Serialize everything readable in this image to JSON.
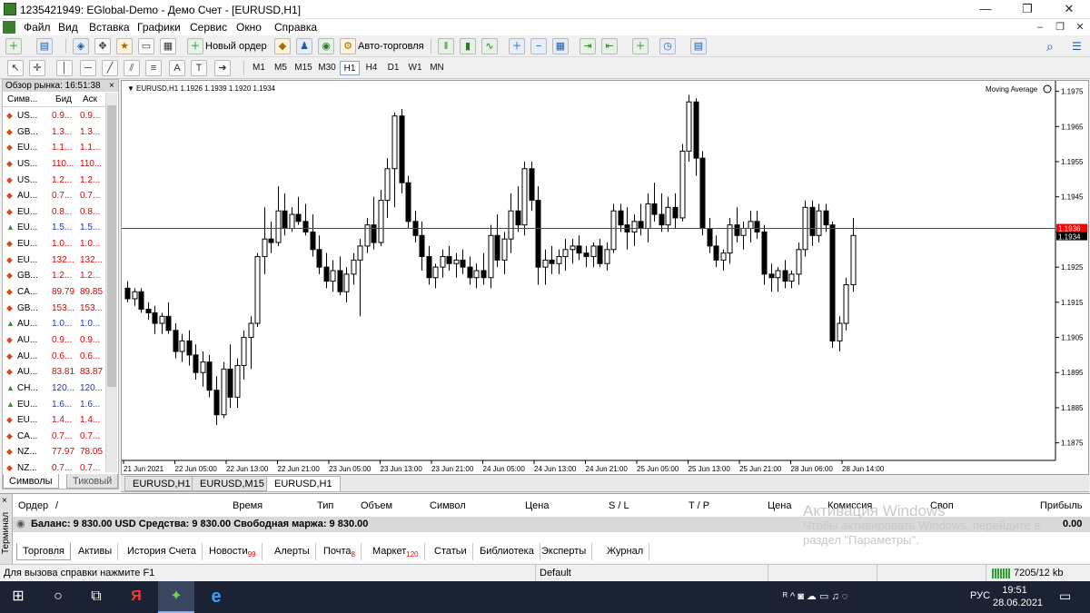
{
  "window": {
    "title": "1235421949: EGlobal-Demo - Демо Счет - [EURUSD,H1]",
    "min": "—",
    "max": "❐",
    "close": "✕",
    "mdi_min": "–",
    "mdi_max": "❐",
    "mdi_close": "✕"
  },
  "menu": [
    "Файл",
    "Вид",
    "Вставка",
    "Графики",
    "Сервис",
    "Окно",
    "Справка"
  ],
  "toolbar": {
    "new_order": "Новый ордер",
    "autotrade": "Авто-торговля",
    "search_icon": "⌕",
    "chat_icon": "☰"
  },
  "timeframes": [
    "M1",
    "M5",
    "M15",
    "M30",
    "H1",
    "H4",
    "D1",
    "W1",
    "MN"
  ],
  "market_watch": {
    "header": "Обзор рынка: 16:51:38",
    "close": "×",
    "columns": [
      "Симв...",
      "Бид",
      "Аск"
    ],
    "rows": [
      {
        "dir": "down",
        "symbol": "US...",
        "bid": "0.9...",
        "ask": "0.9..."
      },
      {
        "dir": "down",
        "symbol": "GB...",
        "bid": "1.3...",
        "ask": "1.3..."
      },
      {
        "dir": "down",
        "symbol": "EU...",
        "bid": "1.1...",
        "ask": "1.1..."
      },
      {
        "dir": "down",
        "symbol": "US...",
        "bid": "110...",
        "ask": "110..."
      },
      {
        "dir": "down",
        "symbol": "US...",
        "bid": "1.2...",
        "ask": "1.2..."
      },
      {
        "dir": "down",
        "symbol": "AU...",
        "bid": "0.7...",
        "ask": "0.7..."
      },
      {
        "dir": "down",
        "symbol": "EU...",
        "bid": "0.8...",
        "ask": "0.8..."
      },
      {
        "dir": "up",
        "symbol": "EU...",
        "bid": "1.5...",
        "ask": "1.5..."
      },
      {
        "dir": "down",
        "symbol": "EU...",
        "bid": "1.0...",
        "ask": "1.0..."
      },
      {
        "dir": "down",
        "symbol": "EU...",
        "bid": "132...",
        "ask": "132..."
      },
      {
        "dir": "down",
        "symbol": "GB...",
        "bid": "1.2...",
        "ask": "1.2..."
      },
      {
        "dir": "down",
        "symbol": "CA...",
        "bid": "89.79",
        "ask": "89.85"
      },
      {
        "dir": "down",
        "symbol": "GB...",
        "bid": "153...",
        "ask": "153..."
      },
      {
        "dir": "up",
        "symbol": "AU...",
        "bid": "1.0...",
        "ask": "1.0..."
      },
      {
        "dir": "down",
        "symbol": "AU...",
        "bid": "0.9...",
        "ask": "0.9..."
      },
      {
        "dir": "down",
        "symbol": "AU...",
        "bid": "0.6...",
        "ask": "0.6..."
      },
      {
        "dir": "down",
        "symbol": "AU...",
        "bid": "83.81",
        "ask": "83.87"
      },
      {
        "dir": "up",
        "symbol": "CH...",
        "bid": "120...",
        "ask": "120..."
      },
      {
        "dir": "up",
        "symbol": "EU...",
        "bid": "1.6...",
        "ask": "1.6..."
      },
      {
        "dir": "down",
        "symbol": "EU...",
        "bid": "1.4...",
        "ask": "1.4..."
      },
      {
        "dir": "down",
        "symbol": "CA...",
        "bid": "0.7...",
        "ask": "0.7..."
      },
      {
        "dir": "down",
        "symbol": "NZ...",
        "bid": "77.97",
        "ask": "78.05"
      },
      {
        "dir": "down",
        "symbol": "NZ...",
        "bid": "0.7...",
        "ask": "0.7..."
      }
    ],
    "tabs": [
      "Символы",
      "Тиковый г"
    ]
  },
  "chart_data": {
    "type": "candlestick",
    "title": "EURUSD,H1  1.1926 1.1939 1.1920 1.1934",
    "indicator": "Moving Average",
    "yticks": [
      "1.1975",
      "1.1965",
      "1.1955",
      "1.1945",
      "1.1935",
      "1.1925",
      "1.1915",
      "1.1905",
      "1.1895",
      "1.1885",
      "1.1875"
    ],
    "ylim": [
      1.187,
      1.1978
    ],
    "xticks": [
      "21 Jun 2021",
      "22 Jun 05:00",
      "22 Jun 13:00",
      "22 Jun 21:00",
      "23 Jun 05:00",
      "23 Jun 13:00",
      "23 Jun 21:00",
      "24 Jun 05:00",
      "24 Jun 13:00",
      "24 Jun 21:00",
      "25 Jun 05:00",
      "25 Jun 13:00",
      "25 Jun 21:00",
      "28 Jun 06:00",
      "28 Jun 14:00"
    ],
    "ask_line": "1.1936",
    "bid_label": "1.1934",
    "ask_value": 1.1936,
    "bid_value": 1.1934,
    "bull_color": "#ffffff",
    "bear_color": "#000000",
    "ask_color": "#ff0000",
    "candles": [
      [
        1.1919,
        1.1921,
        1.1915,
        1.1916
      ],
      [
        1.1916,
        1.1919,
        1.1914,
        1.1918
      ],
      [
        1.1918,
        1.1919,
        1.1912,
        1.1913
      ],
      [
        1.1913,
        1.1915,
        1.191,
        1.1912
      ],
      [
        1.1912,
        1.1914,
        1.1906,
        1.1909
      ],
      [
        1.1909,
        1.1912,
        1.1906,
        1.1911
      ],
      [
        1.1911,
        1.1915,
        1.1906,
        1.1907
      ],
      [
        1.1907,
        1.1909,
        1.1899,
        1.1901
      ],
      [
        1.1901,
        1.1906,
        1.1898,
        1.1904
      ],
      [
        1.1904,
        1.1907,
        1.1897,
        1.19
      ],
      [
        1.19,
        1.1903,
        1.1893,
        1.1895
      ],
      [
        1.1895,
        1.1901,
        1.1891,
        1.1898
      ],
      [
        1.1898,
        1.19,
        1.1888,
        1.189
      ],
      [
        1.189,
        1.1894,
        1.188,
        1.1883
      ],
      [
        1.1883,
        1.1898,
        1.1882,
        1.1896
      ],
      [
        1.1896,
        1.1903,
        1.1885,
        1.1888
      ],
      [
        1.1888,
        1.1899,
        1.1885,
        1.1897
      ],
      [
        1.1897,
        1.1907,
        1.1893,
        1.1905
      ],
      [
        1.1905,
        1.1911,
        1.1896,
        1.1909
      ],
      [
        1.1909,
        1.1929,
        1.1908,
        1.1928
      ],
      [
        1.1928,
        1.1942,
        1.1923,
        1.1933
      ],
      [
        1.1933,
        1.1938,
        1.1929,
        1.1932
      ],
      [
        1.1932,
        1.1948,
        1.1931,
        1.1941
      ],
      [
        1.1941,
        1.1946,
        1.1934,
        1.1936
      ],
      [
        1.1936,
        1.1942,
        1.1935,
        1.194
      ],
      [
        1.194,
        1.1945,
        1.1937,
        1.1938
      ],
      [
        1.1938,
        1.1943,
        1.1934,
        1.1935
      ],
      [
        1.1935,
        1.194,
        1.1928,
        1.193
      ],
      [
        1.193,
        1.1934,
        1.1923,
        1.1925
      ],
      [
        1.1925,
        1.1929,
        1.1919,
        1.1921
      ],
      [
        1.1921,
        1.1927,
        1.1918,
        1.1924
      ],
      [
        1.1924,
        1.1928,
        1.1917,
        1.1918
      ],
      [
        1.1918,
        1.1925,
        1.1915,
        1.1923
      ],
      [
        1.1923,
        1.1929,
        1.192,
        1.1927
      ],
      [
        1.1927,
        1.1933,
        1.1911,
        1.1931
      ],
      [
        1.1931,
        1.1939,
        1.1929,
        1.1937
      ],
      [
        1.1937,
        1.1945,
        1.193,
        1.1932
      ],
      [
        1.1932,
        1.1947,
        1.1931,
        1.1944
      ],
      [
        1.1944,
        1.1956,
        1.1939,
        1.1953
      ],
      [
        1.1953,
        1.1969,
        1.1942,
        1.1968
      ],
      [
        1.1968,
        1.197,
        1.1946,
        1.1949
      ],
      [
        1.1949,
        1.1951,
        1.1936,
        1.1938
      ],
      [
        1.1938,
        1.1941,
        1.1932,
        1.1934
      ],
      [
        1.1934,
        1.1938,
        1.1924,
        1.1928
      ],
      [
        1.1928,
        1.1931,
        1.192,
        1.1922
      ],
      [
        1.1922,
        1.1926,
        1.1919,
        1.1925
      ],
      [
        1.1925,
        1.193,
        1.1922,
        1.1928
      ],
      [
        1.1928,
        1.1931,
        1.1924,
        1.1926
      ],
      [
        1.1926,
        1.1929,
        1.1922,
        1.1927
      ],
      [
        1.1927,
        1.193,
        1.1923,
        1.1925
      ],
      [
        1.1925,
        1.1928,
        1.192,
        1.1922
      ],
      [
        1.1922,
        1.1926,
        1.1919,
        1.1924
      ],
      [
        1.1924,
        1.1929,
        1.192,
        1.1922
      ],
      [
        1.1922,
        1.1937,
        1.1919,
        1.1934
      ],
      [
        1.1934,
        1.194,
        1.1925,
        1.1927
      ],
      [
        1.1927,
        1.1935,
        1.1923,
        1.1933
      ],
      [
        1.1933,
        1.1946,
        1.1929,
        1.1941
      ],
      [
        1.1941,
        1.1948,
        1.1935,
        1.1937
      ],
      [
        1.1937,
        1.1955,
        1.1934,
        1.1953
      ],
      [
        1.1953,
        1.1955,
        1.1941,
        1.1944
      ],
      [
        1.1944,
        1.1948,
        1.192,
        1.1925
      ],
      [
        1.1925,
        1.193,
        1.192,
        1.1927
      ],
      [
        1.1927,
        1.1931,
        1.1923,
        1.1926
      ],
      [
        1.1926,
        1.193,
        1.1923,
        1.1928
      ],
      [
        1.1928,
        1.1933,
        1.1924,
        1.193
      ],
      [
        1.193,
        1.1933,
        1.1926,
        1.1931
      ],
      [
        1.1931,
        1.1934,
        1.1927,
        1.1929
      ],
      [
        1.1929,
        1.1931,
        1.1925,
        1.1928
      ],
      [
        1.1928,
        1.1932,
        1.1925,
        1.1931
      ],
      [
        1.1931,
        1.1933,
        1.1925,
        1.1926
      ],
      [
        1.1926,
        1.1932,
        1.1924,
        1.193
      ],
      [
        1.193,
        1.1943,
        1.1929,
        1.1941
      ],
      [
        1.1941,
        1.1943,
        1.1935,
        1.1937
      ],
      [
        1.1937,
        1.1942,
        1.193,
        1.1935
      ],
      [
        1.1935,
        1.194,
        1.1931,
        1.1938
      ],
      [
        1.1938,
        1.1943,
        1.1934,
        1.1936
      ],
      [
        1.1936,
        1.1946,
        1.1932,
        1.1943
      ],
      [
        1.1943,
        1.1949,
        1.1938,
        1.194
      ],
      [
        1.194,
        1.1946,
        1.1935,
        1.1937
      ],
      [
        1.1937,
        1.1945,
        1.1935,
        1.1942
      ],
      [
        1.1942,
        1.1946,
        1.1936,
        1.1939
      ],
      [
        1.1939,
        1.196,
        1.1938,
        1.1958
      ],
      [
        1.1958,
        1.1974,
        1.1955,
        1.1972
      ],
      [
        1.1972,
        1.1973,
        1.1951,
        1.1956
      ],
      [
        1.1956,
        1.1958,
        1.1934,
        1.1936
      ],
      [
        1.1936,
        1.1939,
        1.1929,
        1.1931
      ],
      [
        1.1931,
        1.1934,
        1.1925,
        1.1927
      ],
      [
        1.1927,
        1.193,
        1.1924,
        1.1929
      ],
      [
        1.1929,
        1.1939,
        1.1926,
        1.1937
      ],
      [
        1.1937,
        1.1942,
        1.1932,
        1.1934
      ],
      [
        1.1934,
        1.1938,
        1.193,
        1.1936
      ],
      [
        1.1936,
        1.1941,
        1.1932,
        1.1938
      ],
      [
        1.1938,
        1.1941,
        1.1933,
        1.1935
      ],
      [
        1.1935,
        1.1937,
        1.192,
        1.1923
      ],
      [
        1.1923,
        1.1926,
        1.1918,
        1.1922
      ],
      [
        1.1922,
        1.1925,
        1.1918,
        1.1924
      ],
      [
        1.1924,
        1.1927,
        1.1919,
        1.1921
      ],
      [
        1.1921,
        1.1924,
        1.1919,
        1.1923
      ],
      [
        1.1923,
        1.1932,
        1.192,
        1.193
      ],
      [
        1.193,
        1.1944,
        1.1928,
        1.1942
      ],
      [
        1.1942,
        1.1944,
        1.1931,
        1.1934
      ],
      [
        1.1934,
        1.1943,
        1.1932,
        1.1941
      ],
      [
        1.1941,
        1.1943,
        1.1935,
        1.1937
      ],
      [
        1.1937,
        1.1938,
        1.1902,
        1.1904
      ],
      [
        1.1904,
        1.1911,
        1.1901,
        1.1909
      ],
      [
        1.1909,
        1.1922,
        1.1907,
        1.192
      ],
      [
        1.192,
        1.1939,
        1.1918,
        1.1934
      ]
    ]
  },
  "chart_tabs": [
    "EURUSD,H1",
    "EURUSD,M15",
    "EURUSD,H1"
  ],
  "terminal": {
    "side_label": "Терминал",
    "close": "×",
    "columns": [
      "Ордер",
      "/",
      "Время",
      "Тип",
      "Объем",
      "Символ",
      "Цена",
      "S / L",
      "T / P",
      "Цена",
      "Комиссия",
      "Своп",
      "Прибыль"
    ],
    "balance": "Баланс: 9 830.00 USD  Средства: 9 830.00  Свободная маржа: 9 830.00",
    "profit": "0.00",
    "tabs": [
      {
        "label": "Торговля",
        "badge": ""
      },
      {
        "label": "Активы",
        "badge": ""
      },
      {
        "label": "История Счета",
        "badge": ""
      },
      {
        "label": "Новости",
        "badge": "99"
      },
      {
        "label": "Алерты",
        "badge": ""
      },
      {
        "label": "Почта",
        "badge": "8"
      },
      {
        "label": "Маркет",
        "badge": "120"
      },
      {
        "label": "Статьи",
        "badge": ""
      },
      {
        "label": "Библиотека",
        "badge": ""
      },
      {
        "label": "Эксперты",
        "badge": ""
      },
      {
        "label": "Журнал",
        "badge": ""
      }
    ]
  },
  "activation": {
    "title": "Активация Windows",
    "line1": "Чтобы активировать Windows, перейдите в",
    "line2": "раздел \"Параметры\"."
  },
  "status": {
    "help": "Для вызова справки нажмите F1",
    "profile": "Default",
    "traffic": "7205/12 kb"
  },
  "taskbar": {
    "start": "⊞",
    "search": "○",
    "taskview": "⧉",
    "yandex": "Я",
    "mt4": "✦",
    "edge": "e",
    "lang": "РУС",
    "time": "19:51",
    "date": "28.06.2021",
    "tray_icons": "ᴿ ^ ◙ ☁ ▭ ♫ ◌",
    "notify": "▭"
  }
}
